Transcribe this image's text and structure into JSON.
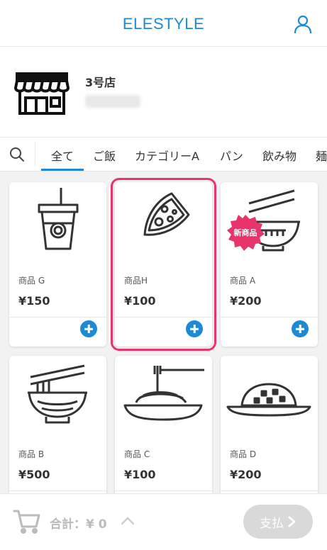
{
  "header": {
    "brand": "ELESTYLE",
    "user_icon": "user-icon"
  },
  "shop": {
    "name": "3号店",
    "icon": "storefront-icon"
  },
  "tabs": {
    "search_icon": "search-icon",
    "items": [
      {
        "label": "全て",
        "active": true
      },
      {
        "label": "ご飯"
      },
      {
        "label": "カテゴリーA"
      },
      {
        "label": "パン"
      },
      {
        "label": "飲み物"
      },
      {
        "label": "麺"
      }
    ]
  },
  "products": [
    {
      "name": "商品 G",
      "price": "¥150",
      "icon": "drink-cup-icon"
    },
    {
      "name": "商品H",
      "price": "¥100",
      "icon": "pizza-slice-icon"
    },
    {
      "name": "商品 A",
      "price": "¥200",
      "icon": "noodle-bowl-icon",
      "badge": "新商品"
    },
    {
      "name": "商品 B",
      "price": "¥500",
      "icon": "ramen-bowl-icon"
    },
    {
      "name": "商品 C",
      "price": "¥100",
      "icon": "spaghetti-plate-icon"
    },
    {
      "name": "商品 D",
      "price": "¥200",
      "icon": "curry-rice-icon"
    }
  ],
  "footer": {
    "total_label": "合計：¥ 0",
    "pay_label": "支払"
  },
  "colors": {
    "accent": "#1e8ad6",
    "highlight": "#e8336b",
    "badge": "#e8336b"
  }
}
